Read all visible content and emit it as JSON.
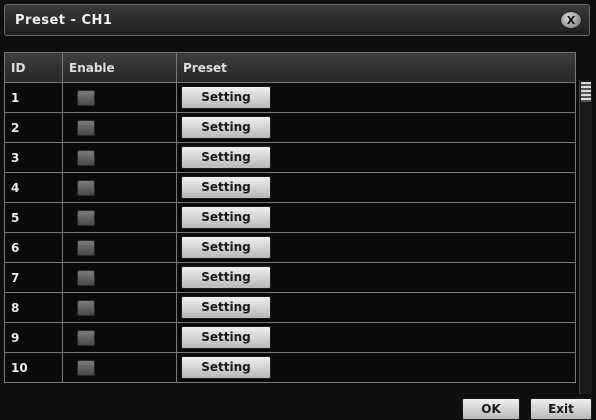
{
  "window": {
    "title": "Preset - CH1",
    "close_label": "X"
  },
  "table": {
    "headers": {
      "id": "ID",
      "enable": "Enable",
      "preset": "Preset"
    },
    "rows": [
      {
        "id": "1",
        "enabled": false,
        "button": "Setting"
      },
      {
        "id": "2",
        "enabled": false,
        "button": "Setting"
      },
      {
        "id": "3",
        "enabled": false,
        "button": "Setting"
      },
      {
        "id": "4",
        "enabled": false,
        "button": "Setting"
      },
      {
        "id": "5",
        "enabled": false,
        "button": "Setting"
      },
      {
        "id": "6",
        "enabled": false,
        "button": "Setting"
      },
      {
        "id": "7",
        "enabled": false,
        "button": "Setting"
      },
      {
        "id": "8",
        "enabled": false,
        "button": "Setting"
      },
      {
        "id": "9",
        "enabled": false,
        "button": "Setting"
      },
      {
        "id": "10",
        "enabled": false,
        "button": "Setting"
      }
    ]
  },
  "footer": {
    "ok_label": "OK",
    "exit_label": "Exit"
  }
}
